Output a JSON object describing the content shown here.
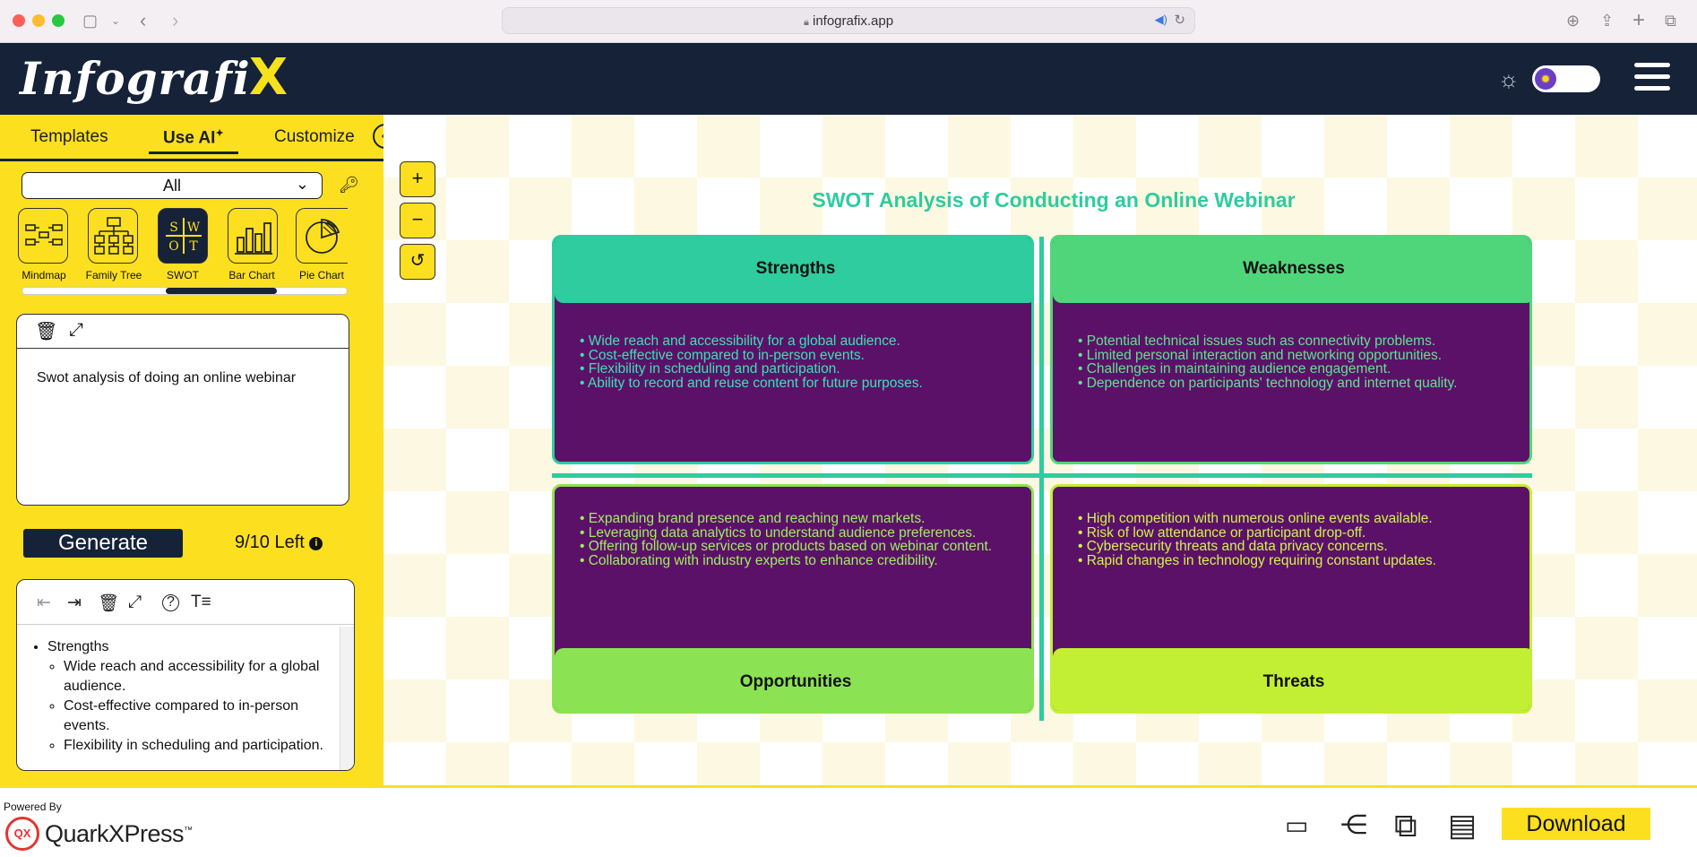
{
  "browser": {
    "url": "infografix.app"
  },
  "header": {
    "logo_text": "Infografi",
    "logo_x": "X"
  },
  "sidebar": {
    "tabs": [
      {
        "label": "Templates"
      },
      {
        "label": "Use AI",
        "active": true
      },
      {
        "label": "Customize"
      }
    ],
    "filter": {
      "value": "All"
    },
    "templates": [
      {
        "label": "Mindmap"
      },
      {
        "label": "Family Tree"
      },
      {
        "label": "SWOT",
        "active": true
      },
      {
        "label": "Bar Chart"
      },
      {
        "label": "Pie Chart"
      }
    ],
    "swot_icon_letters": [
      "S",
      "W",
      "O",
      "T"
    ],
    "prompt": "Swot analysis of doing an online webinar",
    "generate_label": "Generate",
    "remaining": "9/10 Left",
    "outline": {
      "heading": "Strengths",
      "items": [
        "Wide reach and accessibility for a global audience.",
        "Cost-effective compared to in-person events.",
        "Flexibility in scheduling and participation."
      ]
    }
  },
  "canvas": {
    "zoom_in": "+",
    "zoom_out": "−",
    "reset": "↺"
  },
  "swot": {
    "title": "SWOT Analysis of Conducting an Online Webinar",
    "strengths": {
      "label": "Strengths",
      "color": "#2ecc9e",
      "items": [
        "Wide reach and accessibility for a global audience.",
        "Cost-effective compared to in-person events.",
        "Flexibility in scheduling and participation.",
        "Ability to record and reuse content for future purposes."
      ]
    },
    "weaknesses": {
      "label": "Weaknesses",
      "color": "#4fd67a",
      "items": [
        "Potential technical issues such as connectivity problems.",
        "Limited personal interaction and networking opportunities.",
        "Challenges in maintaining audience engagement.",
        "Dependence on participants' technology and internet quality."
      ]
    },
    "opportunities": {
      "label": "Opportunities",
      "color": "#8be353",
      "items": [
        "Expanding brand presence and reaching new markets.",
        "Leveraging data analytics to understand audience preferences.",
        "Offering follow-up services or products based on webinar content.",
        "Collaborating with industry experts to enhance credibility."
      ]
    },
    "threats": {
      "label": "Threats",
      "color": "#c2ef33",
      "items": [
        "High competition with numerous online events available.",
        "Risk of low attendance or participant drop-off.",
        "Cybersecurity threats and data privacy concerns.",
        "Rapid changes in technology requiring constant updates."
      ]
    }
  },
  "footer": {
    "powered_by": "Powered By",
    "brand": "QuarkXPress",
    "brand_tm": "™",
    "qx_badge": "QX",
    "download_label": "Download"
  }
}
